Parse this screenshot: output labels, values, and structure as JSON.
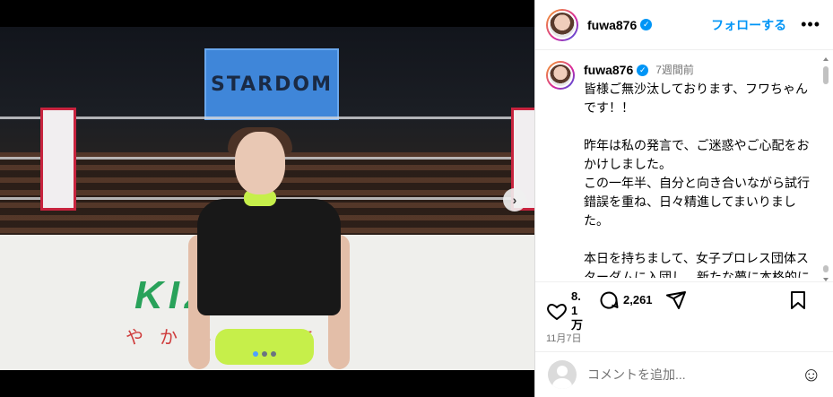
{
  "media": {
    "arena_screen_text": "STARDOM",
    "mat_text": "KIZK",
    "mat_subtext": "やかいのちに",
    "carousel_dots": 3,
    "active_dot": 0,
    "next_arrow": "chevron-right-icon"
  },
  "header": {
    "username": "fuwa876",
    "follow_label": "フォローする",
    "more_label": "•••"
  },
  "caption": {
    "username": "fuwa876",
    "time_ago": "7週間前",
    "text": "皆様ご無沙汰しております、フワちゃんです！！\n\n昨年は私の発言で、ご迷惑やご心配をおかけしました。\nこの一年半、自分と向き合いながら試行錯誤を重ね、日々精進してまいりました。\n\n本日を持ちまして、女子プロレス団体スターダムに入団し、新たな夢に本格的に挑戦します！"
  },
  "actions": {
    "likes": "8.1万",
    "comments": "2,261",
    "date": "11月7日"
  },
  "comment_box": {
    "placeholder": "コメントを追加..."
  },
  "colors": {
    "accent": "#0095f6",
    "verified": "#0095f6"
  }
}
